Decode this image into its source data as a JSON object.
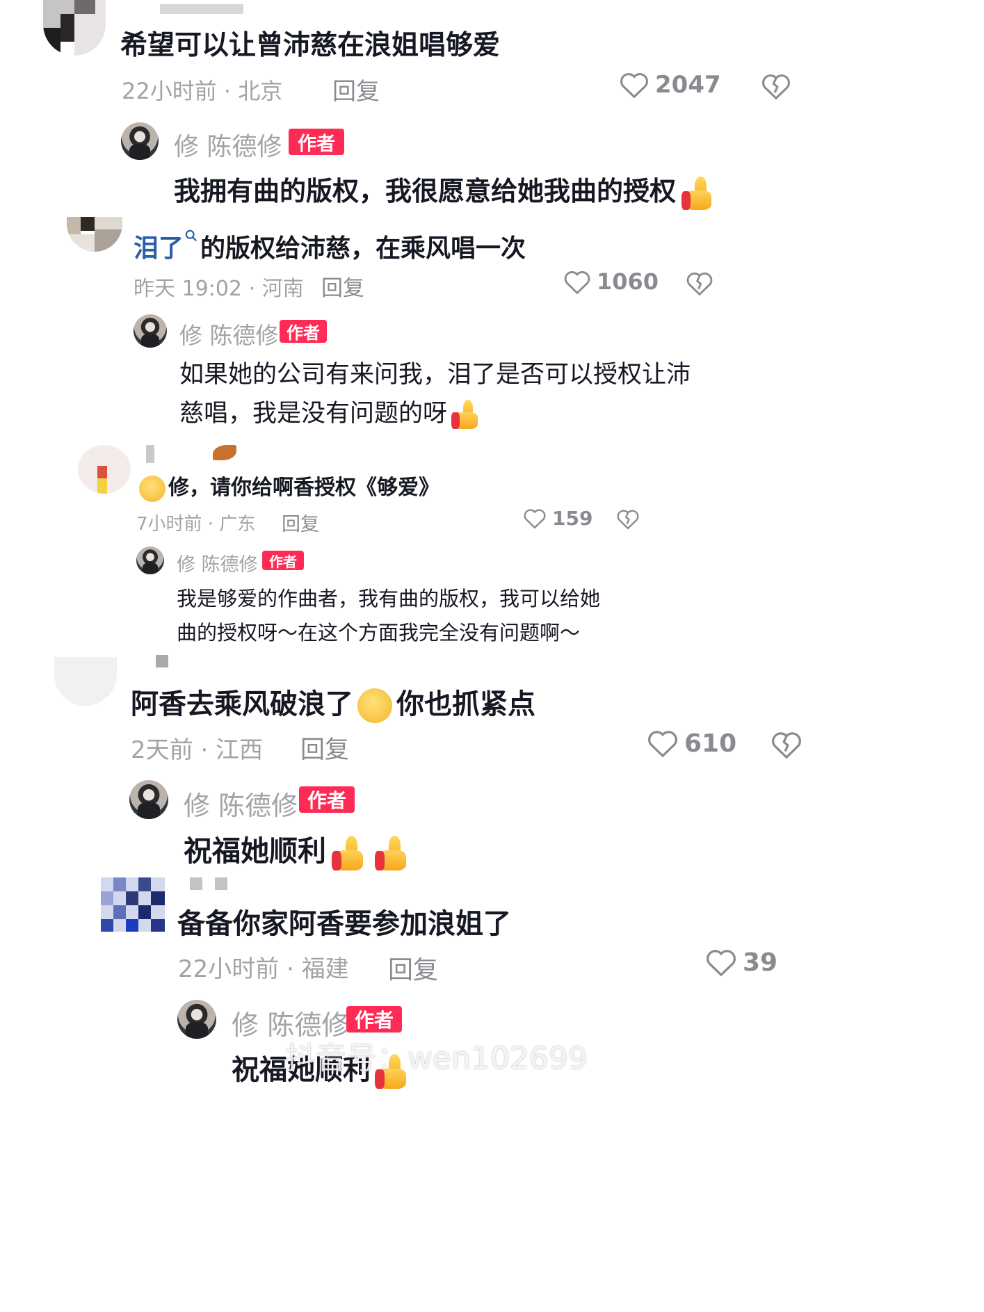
{
  "comments": [
    {
      "text": "希望可以让曾沛慈在浪姐唱够爱",
      "meta": "22小时前 · 北京",
      "reply_label": "回复",
      "likes": "2047",
      "author_reply": {
        "name": "修 陈德修",
        "badge": "作者",
        "text": "我拥有曲的版权，我很愿意给她我曲的授权"
      }
    },
    {
      "link_text": "泪了",
      "text_rest": "的版权给沛慈，在乘风唱一次",
      "meta": "昨天 19:02 · 河南",
      "reply_label": "回复",
      "likes": "1060",
      "author_reply": {
        "name": "修 陈德修",
        "badge": "作者",
        "line1": "如果她的公司有来问我，泪了是否可以授权让沛",
        "line2": "慈唱，我是没有问题的呀"
      }
    },
    {
      "text": "修，请你给啊香授权《够爱》",
      "meta": "7小时前 · 广东",
      "reply_label": "回复",
      "likes": "159",
      "author_reply": {
        "name": "修 陈德修",
        "badge": "作者",
        "line1": "我是够爱的作曲者，我有曲的版权，我可以给她",
        "line2": "曲的授权呀～在这个方面我完全没有问题啊～"
      }
    },
    {
      "text_part1": "阿香去乘风破浪了",
      "text_part2": "你也抓紧点",
      "meta": "2天前 · 江西",
      "reply_label": "回复",
      "likes": "610",
      "author_reply": {
        "name": "修 陈德修",
        "badge": "作者",
        "text": "祝福她顺利"
      }
    },
    {
      "text": "备备你家阿香要参加浪姐了",
      "meta": "22小时前 · 福建",
      "reply_label": "回复",
      "likes": "39",
      "author_reply": {
        "name": "修 陈德修",
        "badge": "作者",
        "text": "祝福她顺利"
      }
    }
  ],
  "watermark": "抖音号：wen102699",
  "colors": {
    "badge": "#fe2c55",
    "link": "#2b5dab",
    "text": "#161823",
    "meta": "#a2a3a7"
  },
  "icons": [
    "heart-outline-icon",
    "broken-heart-icon",
    "search-icon",
    "thumbs-up-emoji-icon",
    "crying-face-emoji-icon",
    "smirk-face-emoji-icon"
  ]
}
